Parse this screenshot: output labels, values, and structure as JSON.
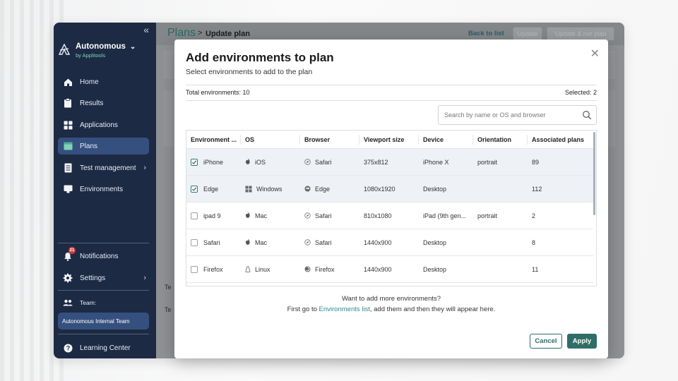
{
  "colors": {
    "sidebar_bg": "#1d2a44",
    "sidebar_active": "#35507e",
    "accent": "#2e6e67",
    "link": "#2b8a89",
    "badge": "#d73c3c"
  },
  "sidebar": {
    "collapse_glyph": "«",
    "brand_name": "Autonomous",
    "brand_chevron": "⌄",
    "brand_sub": "by Applitools",
    "items": [
      {
        "label": "Home",
        "icon": "home-icon"
      },
      {
        "label": "Results",
        "icon": "clipboard-icon"
      },
      {
        "label": "Applications",
        "icon": "grid-icon"
      },
      {
        "label": "Plans",
        "icon": "calendar-icon",
        "active": true
      },
      {
        "label": "Test management",
        "icon": "document-icon",
        "arrow": "›"
      },
      {
        "label": "Environments",
        "icon": "monitor-icon"
      }
    ],
    "notifications_label": "Notifications",
    "notifications_count": "21",
    "settings_label": "Settings",
    "settings_arrow": "›",
    "team_label": "Team:",
    "team_name": "Autonomous Internal Team",
    "learning_label": "Learning Center"
  },
  "header": {
    "crumb_main": "Plans",
    "crumb_sep": ">",
    "crumb_sub": "Update plan",
    "back_link": "Back to list",
    "update_label": "Update",
    "update_run_label": "Update & run plan"
  },
  "modal": {
    "title": "Add environments to plan",
    "subtitle": "Select environments to add to the plan",
    "close_glyph": "✕",
    "total": "Total environments: 10",
    "selected": "Selected: 2",
    "search_placeholder": "Search by name or OS and browser",
    "columns": [
      "Environment ...",
      "OS",
      "Browser",
      "Viewport size",
      "Device",
      "Orientation",
      "Associated plans"
    ],
    "rows": [
      {
        "checked": true,
        "name": "iPhone",
        "os": "iOS",
        "os_icon": "apple-icon",
        "browser": "Safari",
        "browser_icon": "safari-icon",
        "viewport": "375x812",
        "device": "iPhone X",
        "orientation": "portrait",
        "plans": "89"
      },
      {
        "checked": true,
        "name": "Edge",
        "os": "Windows",
        "os_icon": "windows-icon",
        "browser": "Edge",
        "browser_icon": "edge-icon",
        "viewport": "1080x1920",
        "device": "Desktop",
        "orientation": "",
        "plans": "112"
      },
      {
        "checked": false,
        "name": "ipad 9",
        "os": "Mac",
        "os_icon": "apple-icon",
        "browser": "Safari",
        "browser_icon": "safari-icon",
        "viewport": "810x1080",
        "device": "iPad (9th gen...",
        "orientation": "portrait",
        "plans": "2"
      },
      {
        "checked": false,
        "name": "Safari",
        "os": "Mac",
        "os_icon": "apple-icon",
        "browser": "Safari",
        "browser_icon": "safari-icon",
        "viewport": "1440x900",
        "device": "Desktop",
        "orientation": "",
        "plans": "8"
      },
      {
        "checked": false,
        "name": "Firefox",
        "os": "Linux",
        "os_icon": "linux-icon",
        "browser": "Firefox",
        "browser_icon": "firefox-icon",
        "viewport": "1440x900",
        "device": "Desktop",
        "orientation": "",
        "plans": "11"
      }
    ],
    "more_question": "Want to add more environments?",
    "more_prefix": "First go to ",
    "more_link": "Environments list",
    "more_suffix": ", add them and then they will appear here.",
    "cancel_label": "Cancel",
    "apply_label": "Apply"
  },
  "behind": {
    "letter_te": "Te",
    "letter_te2": "Te"
  }
}
